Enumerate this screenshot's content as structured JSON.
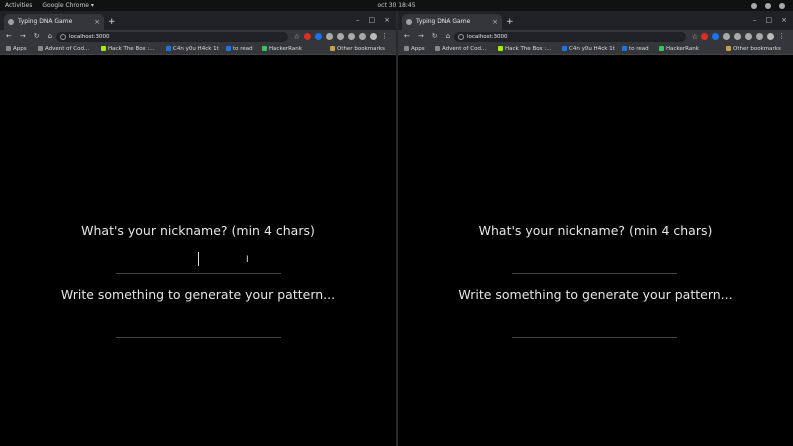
{
  "topbar": {
    "activities": "Activities",
    "app_menu": "Google Chrome ▾",
    "datetime": "oct 30  18:45"
  },
  "windows": [
    {
      "tab_title": "Typing DNA Game",
      "url": "localhost:3000",
      "bookmarks": [
        "Apps",
        "Advent of Cod...",
        "Hack The Box :...",
        "C4n y0u H4ck 1t",
        "to read",
        "HackerRank",
        "Other bookmarks"
      ],
      "nickname_prompt": "What's your nickname? (min 4 chars)",
      "pattern_prompt": "Write something to generate your pattern..."
    },
    {
      "tab_title": "Typing DNA Game",
      "url": "localhost:3000",
      "bookmarks": [
        "Apps",
        "Advent of Cod...",
        "Hack The Box :...",
        "C4n y0u H4ck 1t",
        "to read",
        "HackerRank",
        "Other bookmarks"
      ],
      "nickname_prompt": "What's your nickname? (min 4 chars)",
      "pattern_prompt": "Write something to generate your pattern..."
    }
  ],
  "icons": {
    "tab_close": "×",
    "new_tab": "+",
    "minimize": "–",
    "maximize": "□",
    "close": "×",
    "back": "←",
    "forward": "→",
    "reload": "↻",
    "home": "⌂",
    "star": "☆",
    "menu": "⋮",
    "ibeam": "I"
  },
  "colors": {
    "background": "#000000",
    "chrome_dark": "#202124",
    "chrome_toolbar": "#35363a",
    "text": "#e6e6e6"
  }
}
